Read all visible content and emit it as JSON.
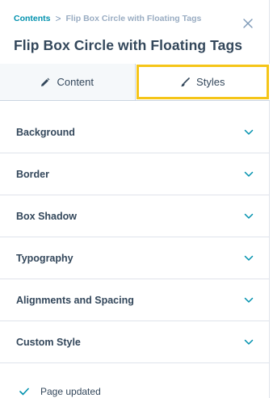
{
  "breadcrumb": {
    "root": "Contents",
    "separator": ">",
    "current": "Flip Box Circle with Floating Tags"
  },
  "title": "Flip Box Circle with Floating Tags",
  "close_icon": "close-icon",
  "tabs": [
    {
      "label": "Content",
      "icon": "pencil-icon",
      "active": false
    },
    {
      "label": "Styles",
      "icon": "brush-icon",
      "active": true
    }
  ],
  "sections": [
    {
      "label": "Background"
    },
    {
      "label": "Border"
    },
    {
      "label": "Box Shadow"
    },
    {
      "label": "Typography"
    },
    {
      "label": "Alignments and Spacing"
    },
    {
      "label": "Custom Style"
    }
  ],
  "status": {
    "text": "Page updated",
    "icon": "check-icon"
  },
  "colors": {
    "link": "#0091ae",
    "text": "#33475b",
    "highlight": "#f5c518",
    "tab_inactive_bg": "#f5f8fa"
  }
}
